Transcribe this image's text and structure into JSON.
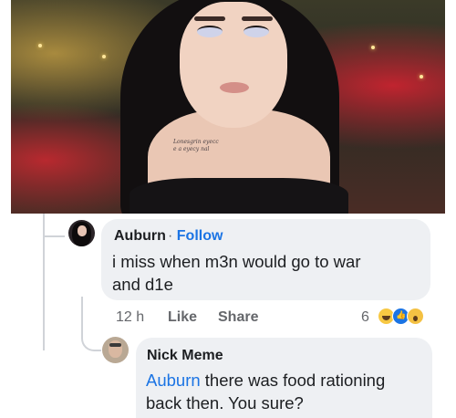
{
  "post_image": {
    "tattoo_text": [
      "Lonesgrin eyecc",
      "e a eyecy nal"
    ]
  },
  "comments": [
    {
      "author": "Auburn",
      "separator": "·",
      "follow_label": "Follow",
      "text_line1": "i miss when m3n would go to war",
      "text_line2": "and d1e",
      "time": "12 h",
      "like_label": "Like",
      "share_label": "Share",
      "reaction_count": "6",
      "reactions": [
        "haha-icon",
        "like-icon",
        "wow-icon"
      ]
    },
    {
      "author": "Nick Meme",
      "mention": "Auburn",
      "text_line1_rest": " there was food rationing",
      "text_line2": "back then. You sure?"
    }
  ],
  "colors": {
    "link": "#1b74e4",
    "bubble": "#eef0f3",
    "meta": "#65676b"
  }
}
